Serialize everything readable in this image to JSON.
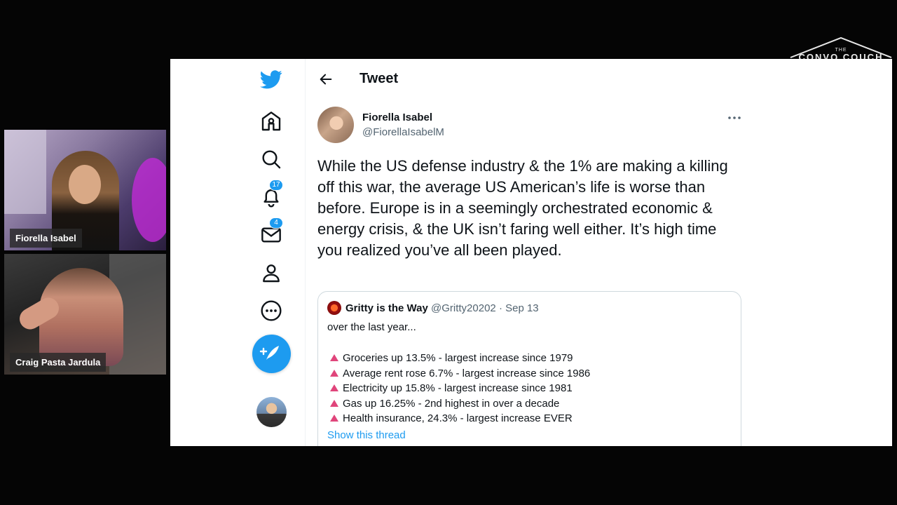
{
  "brand": {
    "small": "THE",
    "big": "CONVO COUCH"
  },
  "video_call": {
    "participants": [
      {
        "name": "Fiorella Isabel"
      },
      {
        "name": "Craig Pasta Jardula"
      }
    ]
  },
  "twitter": {
    "nav": {
      "notifications_count": "17",
      "messages_count": "4"
    },
    "header": {
      "title": "Tweet"
    },
    "tweet": {
      "author_name": "Fiorella Isabel",
      "author_handle": "@FiorellaIsabelM",
      "text": "While the US defense industry & the 1% are making a killing off this war, the average US American’s life is worse than before. Europe is in a seemingly orchestrated economic & energy crisis, & the UK isn’t faring well either. It’s high time you realized you’ve all been played."
    },
    "quoted_tweet": {
      "author_name": "Gritty is the Way",
      "author_handle": "@Gritty20202",
      "date": "· Sep 13",
      "intro": "over the last year...",
      "items": [
        "Groceries up 13.5% - largest increase since 1979",
        "Average rent rose 6.7% - largest increase since 1986",
        "Electricity up 15.8% - largest increase since 1981",
        "Gas up 16.25% - 2nd highest in over a decade",
        "Health insurance, 24.3% - largest increase EVER"
      ],
      "show_thread": "Show this thread"
    }
  },
  "colors": {
    "twitter_blue": "#1d9bf0",
    "triangle": "#e0457b"
  },
  "icons": [
    "twitter-bird-icon",
    "home-icon",
    "explore-icon",
    "notifications-icon",
    "messages-icon",
    "profile-icon",
    "more-icon",
    "compose-icon",
    "back-arrow-icon",
    "more-options-icon"
  ]
}
